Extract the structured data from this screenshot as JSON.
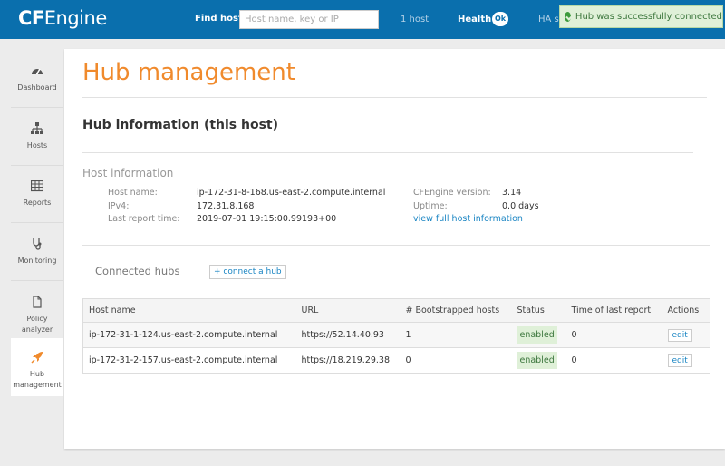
{
  "header": {
    "logo_bold": "CF",
    "logo_rest": "Engine",
    "find_label": "Find host:",
    "find_placeholder": "Host name, key or IP",
    "host_count": "1 host",
    "health_label": "Health",
    "health_status": "Ok",
    "ha_label": "HA s"
  },
  "toast": {
    "message": "Hub was successfully connected"
  },
  "sidebar": {
    "items": [
      {
        "label": "Dashboard",
        "icon": "dashboard-icon"
      },
      {
        "label": "Hosts",
        "icon": "hosts-icon"
      },
      {
        "label": "Reports",
        "icon": "reports-icon"
      },
      {
        "label": "Monitoring",
        "icon": "monitoring-icon"
      },
      {
        "label": "Policy analyzer",
        "icon": "policy-icon"
      },
      {
        "label": "Hub management",
        "icon": "rocket-icon",
        "active": true
      }
    ]
  },
  "main": {
    "title": "Hub management",
    "section_title": "Hub information (this host)",
    "host_info_title": "Host information",
    "host_info": {
      "host_name_label": "Host name:",
      "host_name": "ip-172-31-8-168.us-east-2.compute.internal",
      "ipv4_label": "IPv4:",
      "ipv4": "172.31.8.168",
      "last_report_label": "Last report time:",
      "last_report": "2019-07-01 19:15:00.99193+00",
      "version_label": "CFEngine version:",
      "version": "3.14",
      "uptime_label": "Uptime:",
      "uptime": "0.0 days",
      "full_info_link": "view full host information"
    },
    "connected_hubs_title": "Connected hubs",
    "connect_button": "+ connect a hub",
    "table": {
      "headers": [
        "Host name",
        "URL",
        "# Bootstrapped hosts",
        "Status",
        "Time of last report",
        "Actions"
      ],
      "rows": [
        {
          "host": "ip-172-31-1-124.us-east-2.compute.internal",
          "url": "https://52.14.40.93",
          "bootstrapped": "1",
          "status": "enabled",
          "last_report": "0",
          "action": "edit"
        },
        {
          "host": "ip-172-31-2-157.us-east-2.compute.internal",
          "url": "https://18.219.29.38",
          "bootstrapped": "0",
          "status": "enabled",
          "last_report": "0",
          "action": "edit"
        }
      ]
    }
  },
  "colors": {
    "brand": "#0a6fad",
    "accent": "#f08a2c",
    "link": "#1a85c3",
    "success_bg": "#dff0d8",
    "success_text": "#3c763d"
  }
}
